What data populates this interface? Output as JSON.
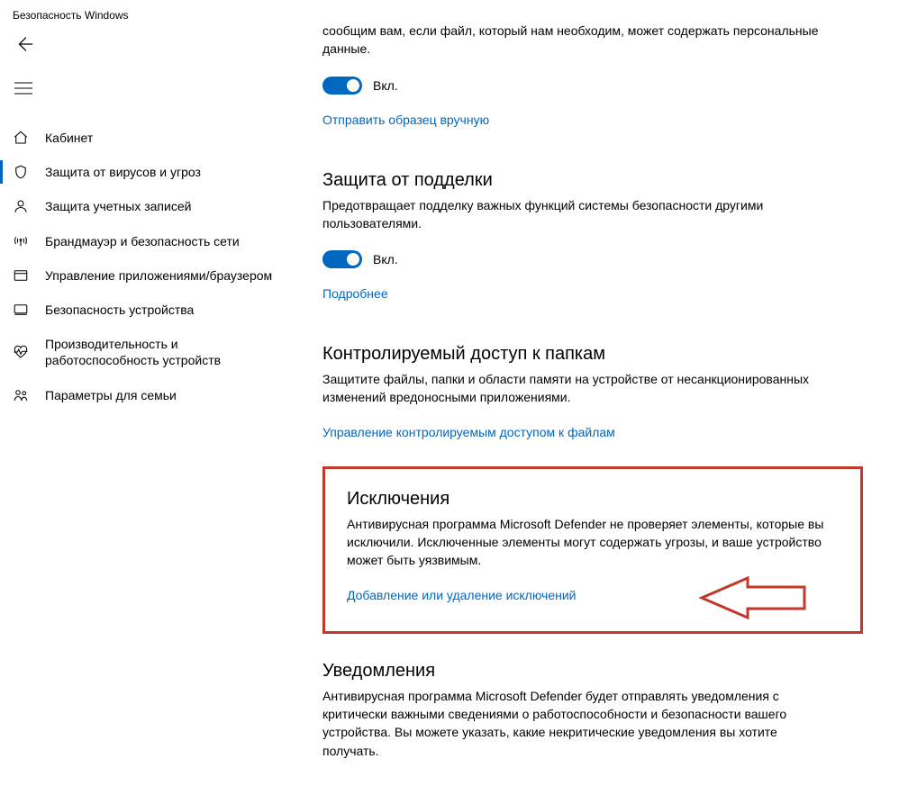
{
  "app_title": "Безопасность Windows",
  "sidebar": {
    "items": [
      {
        "label": "Кабинет"
      },
      {
        "label": "Защита от вирусов и угроз"
      },
      {
        "label": "Защита учетных записей"
      },
      {
        "label": "Брандмауэр и безопасность сети"
      },
      {
        "label": "Управление приложениями/браузером"
      },
      {
        "label": "Безопасность устройства"
      },
      {
        "label": "Производительность и работоспособность устройств"
      },
      {
        "label": "Параметры для семьи"
      }
    ]
  },
  "toggle_on_label": "Вкл.",
  "sample_section": {
    "desc": "сообщим вам, если файл, который нам необходим, может содержать персональные данные.",
    "link": "Отправить образец вручную"
  },
  "tamper_section": {
    "heading": "Защита от подделки",
    "desc": "Предотвращает подделку важных функций системы безопасности другими пользователями.",
    "link": "Подробнее"
  },
  "cfa_section": {
    "heading": "Контролируемый доступ к папкам",
    "desc": "Защитите файлы, папки и области памяти на устройстве от несанкционированных изменений вредоносными приложениями.",
    "link": "Управление контролируемым доступом к файлам"
  },
  "exclusions_section": {
    "heading": "Исключения",
    "desc": "Антивирусная программа Microsoft Defender не проверяет элементы, которые вы исключили. Исключенные элементы могут содержать угрозы, и ваше устройство может быть уязвимым.",
    "link": "Добавление или удаление исключений"
  },
  "notifications_section": {
    "heading": "Уведомления",
    "desc": "Антивирусная программа Microsoft Defender будет отправлять уведомления с критически важными сведениями о работоспособности и безопасности вашего устройства. Вы можете указать, какие некритические уведомления вы хотите получать."
  }
}
